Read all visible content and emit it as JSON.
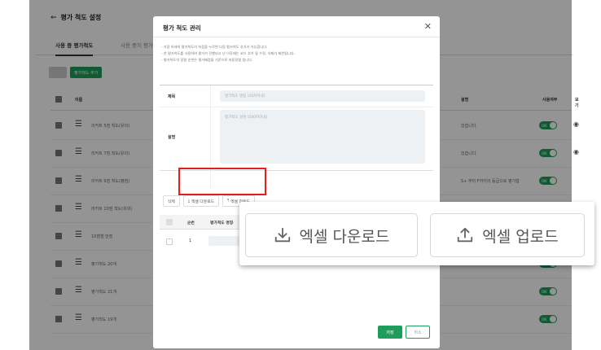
{
  "background": {
    "page_title": "평가 척도 설정",
    "tabs": [
      "사용 중 평가척도",
      "사용 중지 평가척도"
    ],
    "buttons": {
      "add": "평가척도 추가"
    },
    "table_header": {
      "name": "이름",
      "description": "설명",
      "in_use": "사용여부",
      "view": "보기"
    },
    "rows": [
      {
        "name": "리커트 5점 척도(유의)",
        "desc": "있습니다.",
        "toggle": "ON"
      },
      {
        "name": "리커트 7점 척도(유의)",
        "desc": "있습니다.",
        "toggle": "ON"
      },
      {
        "name": "리커트 9점 척도(평점)",
        "desc": "S+ 부터 F까지의 등급으로 평가합",
        "toggle": "ON"
      },
      {
        "name": "리커트 10점 척도(유의)",
        "desc": "",
        "toggle": "ON"
      },
      {
        "name": "10점형 만점",
        "desc": "",
        "toggle": "ON"
      },
      {
        "name": "평가척도 20개",
        "desc": "",
        "toggle": "ON"
      },
      {
        "name": "평가척도 21개",
        "desc": "",
        "toggle": "ON"
      },
      {
        "name": "평가척도 19개",
        "desc": "",
        "toggle": "ON"
      }
    ]
  },
  "modal": {
    "title": "평가 척도 관리",
    "notes": [
      "- 가장 아래의 평가척도의 처점을 누르면 다음 평가척도 추가가 가능합니다.",
      "- 한 평가척도를 사용하여 평가가 진행되고 난 이후에는 코드 추가 및 수정, 삭제가 제한됩니다.",
      "- 평가척도의 정렬 순번은 평가배점을 기준으로 자동정렬 됩니다."
    ],
    "form": {
      "title_label": "제목",
      "title_placeholder": "평가척도 명칭 (20자이내)",
      "desc_label": "설명",
      "desc_placeholder": "평가척도 설명 (500자이내)"
    },
    "toolbar": {
      "delete": "삭제",
      "excel_download": "엑셀 다운로드",
      "excel_upload": "엑셀 업로드"
    },
    "table": {
      "col_order": "순번",
      "col_name": "평가척도 명칭",
      "rows": [
        {
          "order": "1"
        }
      ]
    },
    "footer": {
      "save": "저장",
      "cancel": "취소"
    }
  },
  "zoom": {
    "excel_download": "엑셀 다운로드",
    "excel_upload": "엑셀 업로드"
  },
  "colors": {
    "accent_green": "#1e9e5a",
    "highlight_red": "#e81c1c"
  }
}
